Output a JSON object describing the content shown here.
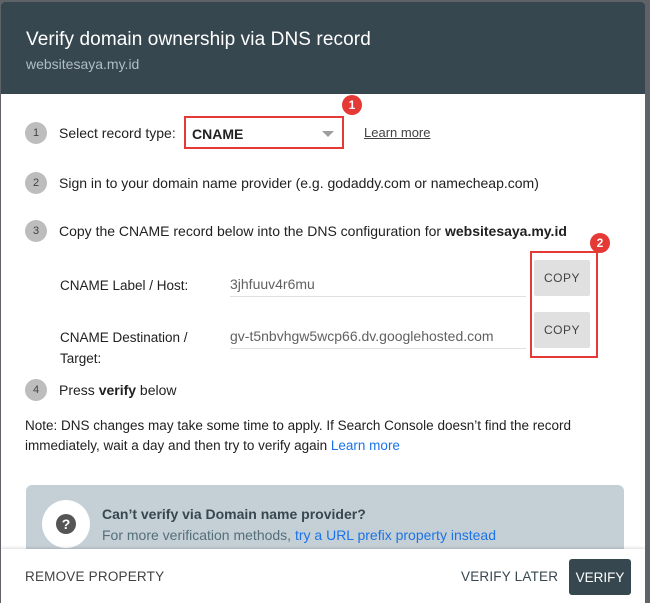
{
  "dialog": {
    "title": "Verify domain ownership via DNS record",
    "subtitle": "websitesaya.my.id"
  },
  "steps": [
    {
      "number": "1",
      "text": "Select record type:"
    },
    {
      "number": "2",
      "text": "Sign in to your domain name provider (e.g. godaddy.com or namecheap.com)"
    },
    {
      "number": "3",
      "text_before": "Copy the CNAME record below into the DNS configuration for ",
      "text_bold": "websitesaya.my.id"
    },
    {
      "number": "4",
      "text_before": "Press ",
      "text_bold": "verify",
      "text_after": " below"
    }
  ],
  "record_type": {
    "selected": "CNAME",
    "learn_more": "Learn more"
  },
  "annotations": {
    "badge1": "1",
    "badge2": "2",
    "highlight_color": "#e53935"
  },
  "fields": [
    {
      "label": "CNAME Label / Host:",
      "value": "3jhfuuv4r6mu",
      "copy_label": "COPY"
    },
    {
      "label_line1": "CNAME Destination /",
      "label_line2": "Target:",
      "value": "gv-t5nbvhgw5wcp66.dv.googlehosted.com",
      "copy_label": "COPY"
    }
  ],
  "note": {
    "text": "Note: DNS changes may take some time to apply. If Search Console doesn’t find the record immediately, wait a day and then try to verify again ",
    "link": "Learn more"
  },
  "help": {
    "icon": "help-question-icon",
    "title": "Can’t verify via Domain name provider?",
    "text": "For more verification methods, ",
    "link": "try a URL prefix property instead"
  },
  "footer": {
    "remove": "REMOVE PROPERTY",
    "verify_later": "VERIFY LATER",
    "verify": "VERIFY"
  },
  "colors": {
    "header_bg": "#37474f",
    "link": "#1a73e8",
    "annotation_red": "#e53935"
  }
}
